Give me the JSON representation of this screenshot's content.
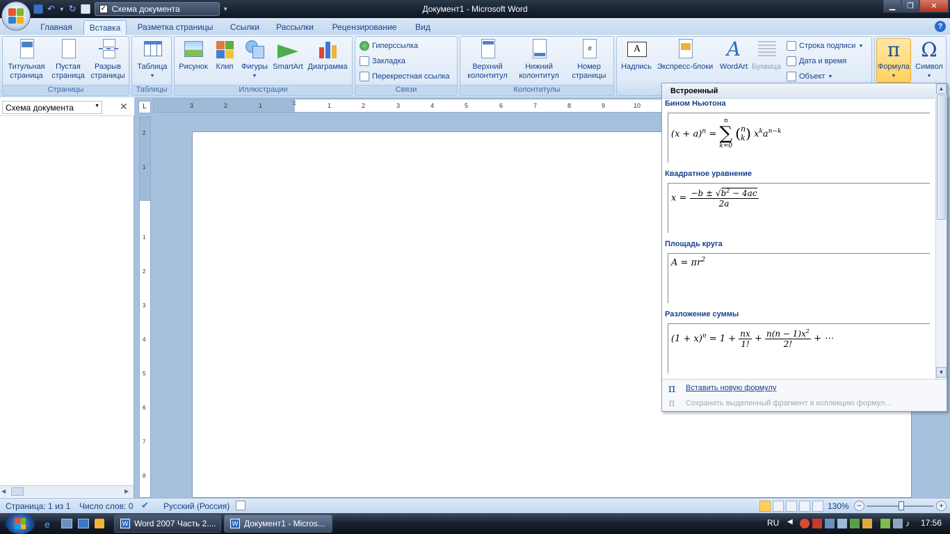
{
  "window": {
    "title": "Документ1 - Microsoft Word",
    "qat_doc_map": "Схема документа"
  },
  "tabs": [
    "Главная",
    "Вставка",
    "Разметка страницы",
    "Ссылки",
    "Рассылки",
    "Рецензирование",
    "Вид"
  ],
  "active_tab": "Вставка",
  "ribbon": {
    "pages": {
      "label": "Страницы",
      "cover": "Титульная\nстраница",
      "blank": "Пустая\nстраница",
      "break": "Разрыв\nстраницы"
    },
    "tables": {
      "label": "Таблицы",
      "table": "Таблица"
    },
    "illustrations": {
      "label": "Иллюстрации",
      "picture": "Рисунок",
      "clip": "Клип",
      "shapes": "Фигуры",
      "smartart": "SmartArt",
      "chart": "Диаграмма"
    },
    "links": {
      "label": "Связи",
      "hyperlink": "Гиперссылка",
      "bookmark": "Закладка",
      "crossref": "Перекрестная ссылка"
    },
    "headers": {
      "label": "Колонтитулы",
      "header": "Верхний\nколонтитул",
      "footer": "Нижний\nколонтитул",
      "page_number": "Номер\nстраницы"
    },
    "text": {
      "textbox": "Надпись",
      "quickparts": "Экспресс-блоки",
      "wordart": "WordArt",
      "dropcap": "Буквица",
      "signature": "Строка подписи",
      "datetime": "Дата и время",
      "object": "Объект"
    },
    "symbols": {
      "equation": "Формула",
      "symbol": "Символ"
    }
  },
  "doc_map": {
    "select_value": "Схема документа"
  },
  "ruler": {
    "h_marks": [
      "3",
      "2",
      "1",
      "1",
      "2",
      "3",
      "4",
      "5",
      "6",
      "7",
      "8",
      "9",
      "10"
    ],
    "v_marks": [
      "2",
      "1",
      "1",
      "2",
      "3",
      "4",
      "5",
      "6",
      "7",
      "8"
    ]
  },
  "gallery": {
    "header": "Встроенный",
    "equations": [
      {
        "title": "Бином Ньютона"
      },
      {
        "title": "Квадратное уравнение"
      },
      {
        "title": "Площадь круга"
      },
      {
        "title": "Разложение суммы"
      }
    ],
    "insert_new": "Вставить новую формулу",
    "save_selection": "Сохранить выделенный фрагмент в коллекцию формул..."
  },
  "status": {
    "page": "Страница: 1 из 1",
    "words": "Число слов: 0",
    "language": "Русский (Россия)",
    "zoom": "130%"
  },
  "taskbar": {
    "items": [
      "Word 2007 Часть 2....",
      "Документ1 - Micros..."
    ],
    "lang": "RU",
    "clock": "17:56"
  }
}
